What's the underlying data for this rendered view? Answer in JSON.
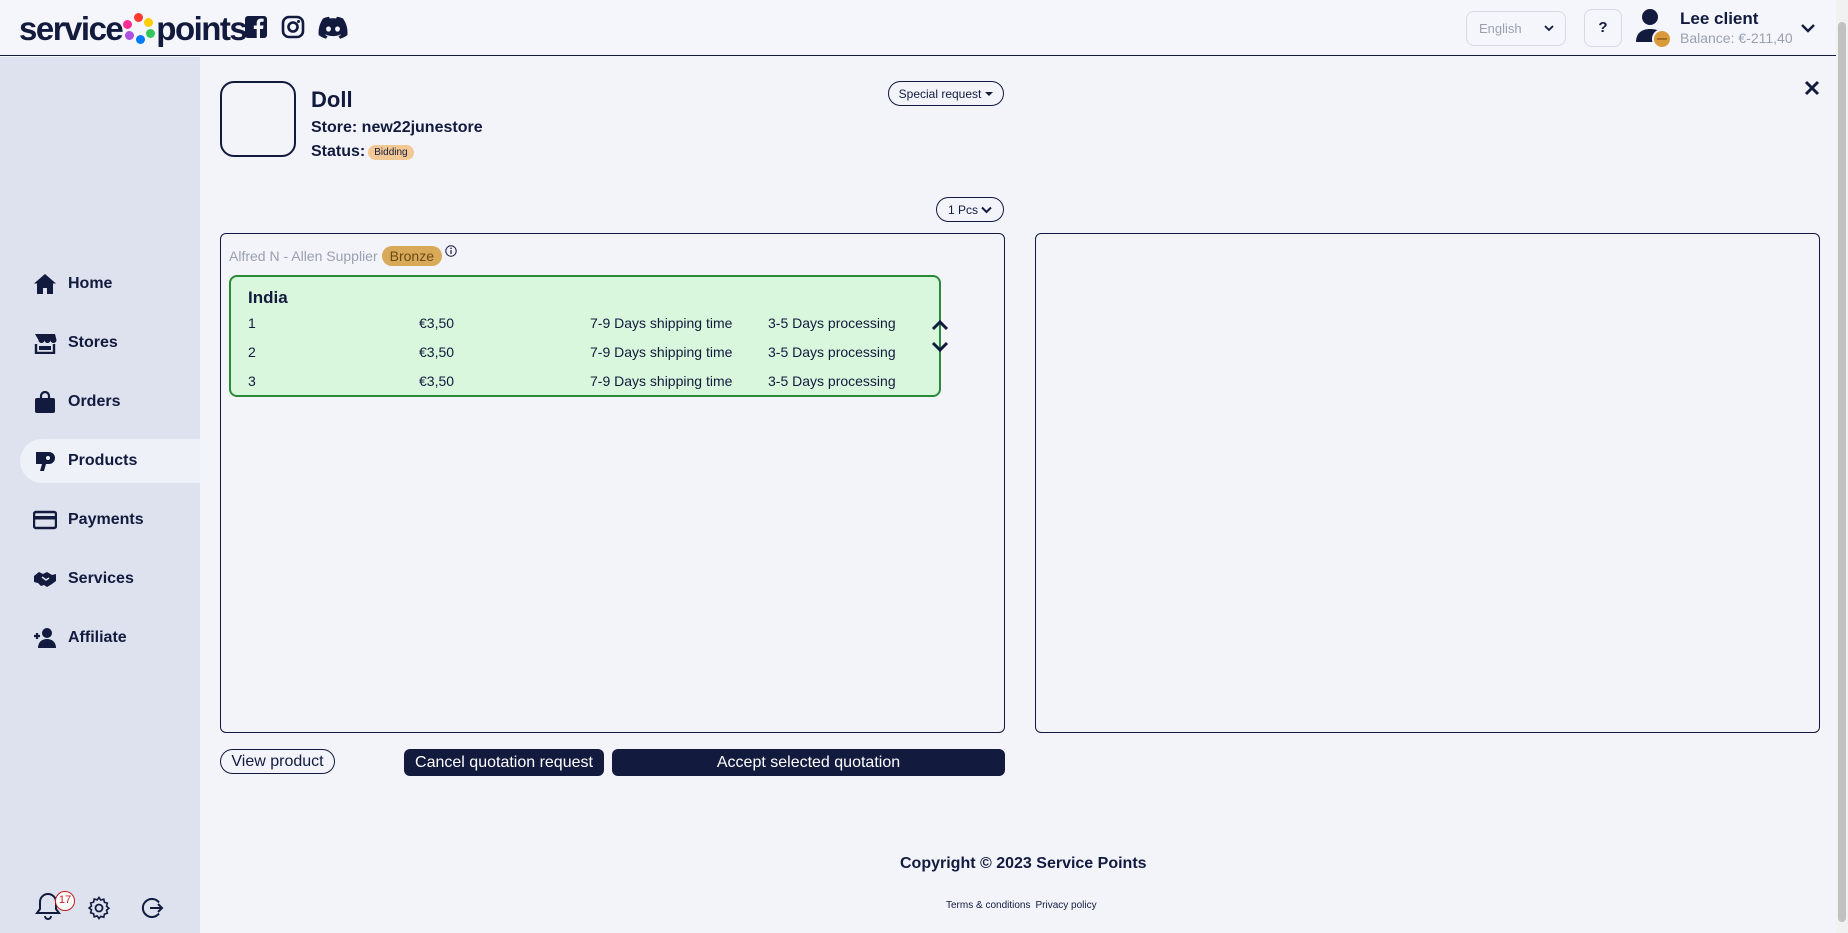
{
  "header": {
    "logo_left": "service",
    "logo_right": "points",
    "language": "English",
    "help_label": "?",
    "user_name": "Lee client",
    "balance": "Balance: €-211,40"
  },
  "sidebar": {
    "items": [
      {
        "label": "Home",
        "icon": "home-icon"
      },
      {
        "label": "Stores",
        "icon": "store-icon"
      },
      {
        "label": "Orders",
        "icon": "shopping-bag-icon"
      },
      {
        "label": "Products",
        "icon": "hair-dryer-icon"
      },
      {
        "label": "Payments",
        "icon": "credit-card-icon"
      },
      {
        "label": "Services",
        "icon": "handshake-icon"
      },
      {
        "label": "Affiliate",
        "icon": "user-plus-icon"
      }
    ],
    "active": "Products",
    "notification_count": "17"
  },
  "product": {
    "title": "Doll",
    "store": "Store: new22junestore",
    "status_label": "Status:",
    "status_value": "Bidding",
    "special_request": "Special request",
    "quantity": "1 Pcs"
  },
  "supplier": {
    "name": "Alfred N - Allen Supplier",
    "tier": "Bronze"
  },
  "quote": {
    "country": "India",
    "rows": [
      {
        "qty": "1",
        "price": "€3,50",
        "shipping": "7-9 Days shipping time",
        "processing": "3-5 Days processing"
      },
      {
        "qty": "2",
        "price": "€3,50",
        "shipping": "7-9 Days shipping time",
        "processing": "3-5 Days processing"
      },
      {
        "qty": "3",
        "price": "€3,50",
        "shipping": "7-9 Days shipping time",
        "processing": "3-5 Days processing"
      }
    ]
  },
  "actions": {
    "view_product": "View product",
    "cancel": "Cancel quotation request",
    "accept": "Accept selected quotation"
  },
  "footer": {
    "copyright": "Copyright © 2023 Service Points",
    "terms": "Terms & conditions",
    "privacy": "Privacy policy"
  },
  "colors": {
    "primary": "#121a3e",
    "sidebar": "#dde2ee",
    "quote_bg": "#d9f7dc",
    "quote_border": "#2b8a35",
    "tier_bronze": "#d9a95a",
    "badge_red": "#c21c1c"
  }
}
